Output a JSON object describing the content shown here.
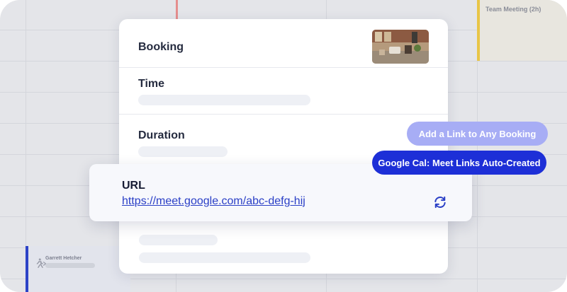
{
  "calendar": {
    "team_event_title": "Team Meeting (2h)",
    "attendee_event_name": "Garrett Hetcher",
    "colors": {
      "team_event_accent": "#e8c547",
      "attendee_event_accent": "#2d43c7",
      "now_indicator": "#e58e8e"
    }
  },
  "booking_card": {
    "title": "Booking",
    "thumbnail_icon": "office-lobby-photo",
    "time_label": "Time",
    "duration_label": "Duration"
  },
  "url_card": {
    "label": "URL",
    "link": "https://meet.google.com/abc-defg-hij",
    "refresh_icon": "refresh-icon"
  },
  "chips": {
    "add_link": "Add a Link to Any Booking",
    "google_cal": "Google Cal: Meet Links Auto-Created"
  },
  "colors": {
    "accent": "#1d2fd7",
    "accent_light": "#a7adf5",
    "link": "#2a3fc6"
  }
}
